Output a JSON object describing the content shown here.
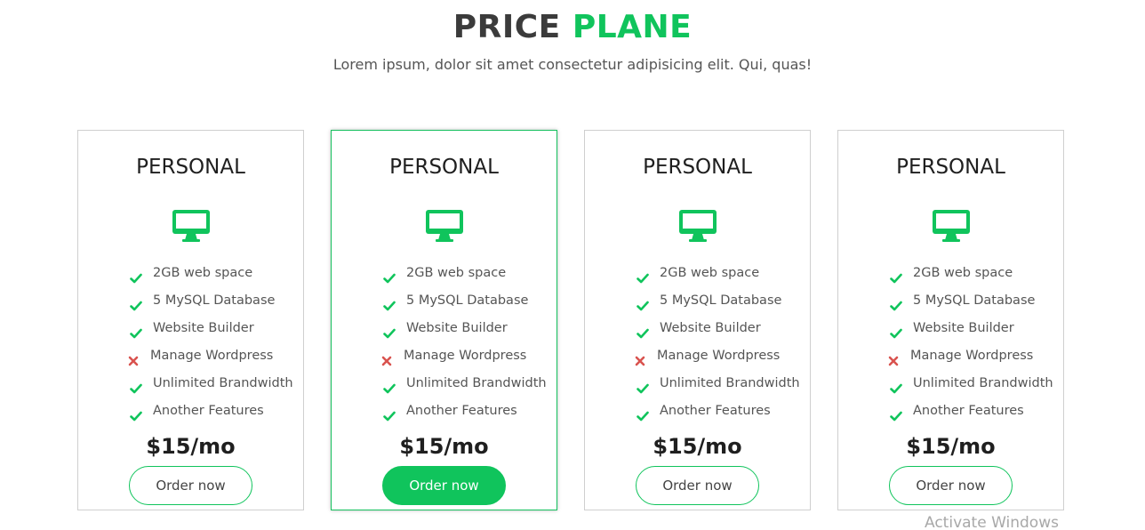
{
  "header": {
    "title_part1": "PRICE",
    "title_part2": "PLANE",
    "subtitle": "Lorem ipsum, dolor sit amet consectetur adipisicing elit. Qui, quas!"
  },
  "colors": {
    "accent": "#10c45c",
    "cross": "#d9534f",
    "text": "#555555"
  },
  "plans": [
    {
      "title": "PERSONAL",
      "icon": "monitor-icon",
      "features": [
        {
          "label": "2GB web space",
          "included": true
        },
        {
          "label": "5 MySQL Database",
          "included": true
        },
        {
          "label": "Website Builder",
          "included": true
        },
        {
          "label": "Manage Wordpress",
          "included": false
        },
        {
          "label": "Unlimited Brandwidth",
          "included": true
        },
        {
          "label": "Another Features",
          "included": true
        }
      ],
      "price": "$15/mo",
      "button": "Order now",
      "highlighted": false
    },
    {
      "title": "PERSONAL",
      "icon": "monitor-icon",
      "features": [
        {
          "label": "2GB web space",
          "included": true
        },
        {
          "label": "5 MySQL Database",
          "included": true
        },
        {
          "label": "Website Builder",
          "included": true
        },
        {
          "label": "Manage Wordpress",
          "included": false
        },
        {
          "label": "Unlimited Brandwidth",
          "included": true
        },
        {
          "label": "Another Features",
          "included": true
        }
      ],
      "price": "$15/mo",
      "button": "Order now",
      "highlighted": true
    },
    {
      "title": "PERSONAL",
      "icon": "monitor-icon",
      "features": [
        {
          "label": "2GB web space",
          "included": true
        },
        {
          "label": "5 MySQL Database",
          "included": true
        },
        {
          "label": "Website Builder",
          "included": true
        },
        {
          "label": "Manage Wordpress",
          "included": false
        },
        {
          "label": "Unlimited Brandwidth",
          "included": true
        },
        {
          "label": "Another Features",
          "included": true
        }
      ],
      "price": "$15/mo",
      "button": "Order now",
      "highlighted": false
    },
    {
      "title": "PERSONAL",
      "icon": "monitor-icon",
      "features": [
        {
          "label": "2GB web space",
          "included": true
        },
        {
          "label": "5 MySQL Database",
          "included": true
        },
        {
          "label": "Website Builder",
          "included": true
        },
        {
          "label": "Manage Wordpress",
          "included": false
        },
        {
          "label": "Unlimited Brandwidth",
          "included": true
        },
        {
          "label": "Another Features",
          "included": true
        }
      ],
      "price": "$15/mo",
      "button": "Order now",
      "highlighted": false
    }
  ],
  "watermark": "Activate Windows"
}
